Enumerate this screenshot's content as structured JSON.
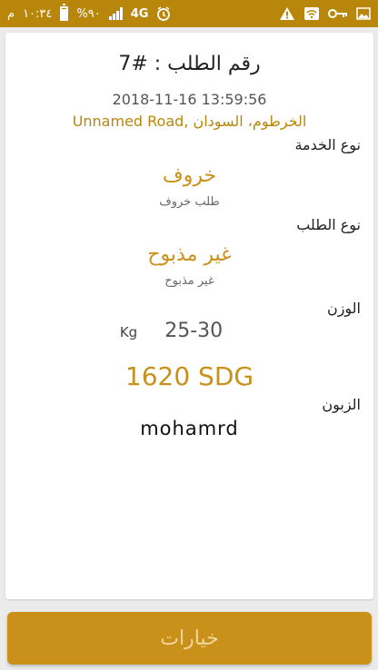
{
  "status_bar": {
    "time": "١٠:٣٤",
    "time_suffix": "م",
    "battery_text": "%٩٠",
    "network": "4G"
  },
  "order": {
    "title": "رقم الطلب : #7",
    "datetime": "2018-11-16 13:59:56",
    "address": "الخرطوم، السودان ,Unnamed Road",
    "service_label": "نوع الخدمة",
    "service_value": "خروف",
    "service_sub": "طلب خروف",
    "order_type_label": "نوع الطلب",
    "order_type_value": "غير مذبوح",
    "order_type_sub": "غير مذبوح",
    "weight_label": "الوزن",
    "weight_value": "25-30",
    "weight_unit": "Kg",
    "price": "1620 SDG",
    "customer_label": "الزبون",
    "customer_name": "mohamrd"
  },
  "actions": {
    "options_label": "خيارات"
  },
  "colors": {
    "accent": "#c9901a",
    "status_bar": "#b8860b"
  }
}
